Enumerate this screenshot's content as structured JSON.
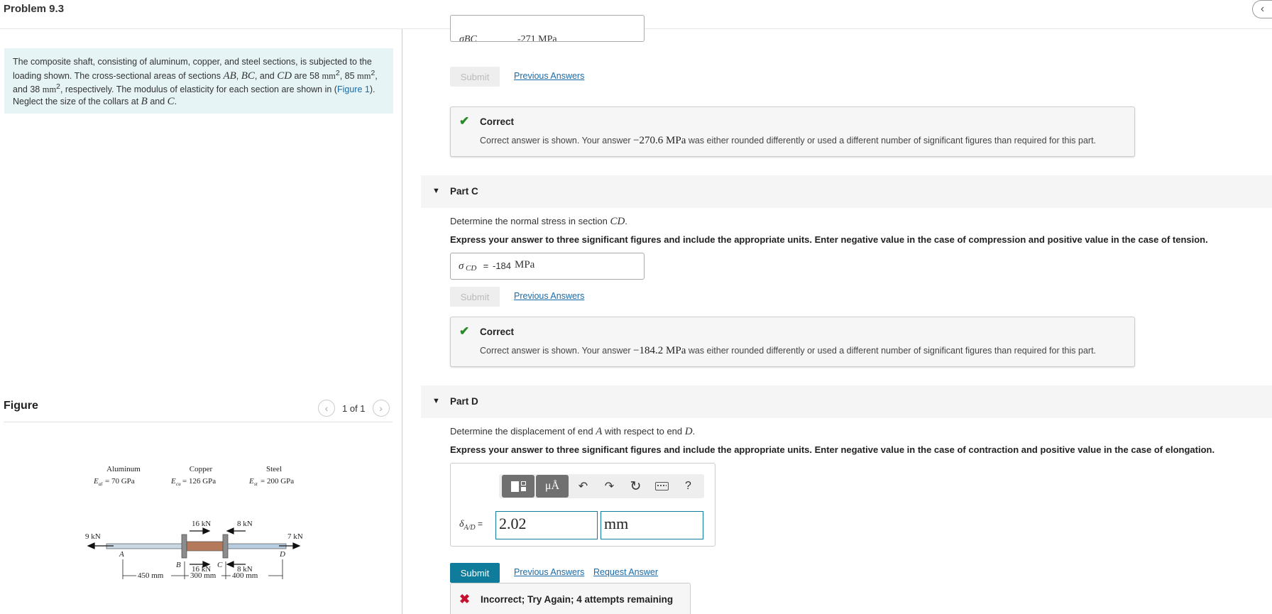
{
  "header": {
    "title": "Problem 9.3",
    "collapse_glyph": "‹"
  },
  "problem": {
    "text_1": "The composite shaft, consisting of aluminum, copper, and steel sections, is subjected to the loading shown. The cross-sectional areas of sections ",
    "ab": "AB",
    "bc": "BC",
    "cd": "CD",
    "and": "and",
    "text_2": " are 58 ",
    "unit": "mm",
    "text_3": ", 85 ",
    "text_4": ", and 38 ",
    "text_5": ", respectively. The modulus of elasticity for each section are shown in (",
    "figure_link": "Figure 1",
    "text_6": "). Neglect the size of the collars at ",
    "b": "B",
    "c": "C",
    "period": "."
  },
  "figure": {
    "label": "Figure",
    "pager": "1 of 1",
    "materials": [
      {
        "name": "Aluminum",
        "modulus": "= 70 GPa",
        "sym": "E",
        "sub": "al"
      },
      {
        "name": "Copper",
        "modulus": "= 126 GPa",
        "sym": "E",
        "sub": "cu"
      },
      {
        "name": "Steel",
        "modulus": "= 200 GPa",
        "sym": "E",
        "sub": "st"
      }
    ],
    "loads": {
      "a": "9 kN",
      "b_top": "16 kN",
      "b_bottom": "16 kN",
      "c_top": "8 kN",
      "c_bottom": "8 kN",
      "d": "7 kN"
    },
    "points": {
      "a": "A",
      "b": "B",
      "c": "C",
      "d": "D"
    },
    "dims": {
      "ab": "450 mm",
      "bc": "300 mm",
      "cd": "400 mm"
    },
    "colors": {
      "aluminum": "#c9d8e4",
      "copper": "#b4785a",
      "steel": "#b8cde0",
      "collar": "#8c8c8c"
    }
  },
  "part_b": {
    "answer_label_partial": "σBC",
    "answer_value_partial": "-271 MPa",
    "submit": "Submit",
    "previous": "Previous Answers",
    "feedback": {
      "status": "Correct",
      "msg_1": "Correct answer is shown. Your answer ",
      "value": "−270.6 MPa",
      "msg_2": " was either rounded differently or used a different number of significant figures than required for this part."
    }
  },
  "part_c": {
    "title": "Part C",
    "question_1": "Determine the normal stress in section ",
    "question_var": "CD",
    "question_2": ".",
    "instructions": "Express your answer to three significant figures and include the appropriate units. Enter negative value in the case of compression and positive value in the case of tension.",
    "answer_label": "σ",
    "answer_sub": "CD",
    "answer_eq": " = ",
    "answer_num": "-184",
    "answer_unit": "MPa",
    "submit": "Submit",
    "previous": "Previous Answers",
    "feedback": {
      "status": "Correct",
      "msg_1": "Correct answer is shown. Your answer ",
      "value": "−184.2 MPa",
      "msg_2": " was either rounded differently or used a different number of significant figures than required for this part."
    }
  },
  "part_d": {
    "title": "Part D",
    "question_1": "Determine the displacement of end ",
    "question_var_a": "A",
    "question_2": " with respect to end ",
    "question_var_d": "D",
    "question_3": ".",
    "instructions": "Express your answer to three significant figures and include the appropriate units. Enter negative value in the case of contraction and positive value in the case of elongation.",
    "delta_label": "δ",
    "delta_sub": "A/D",
    "delta_eq": " = ",
    "value": "2.02",
    "unit": "mm",
    "toolbar": {
      "units": "μÅ",
      "help": "?"
    },
    "submit": "Submit",
    "previous": "Previous Answers",
    "request": "Request Answer",
    "feedback": {
      "status": "Incorrect; Try Again; 4 attempts remaining"
    }
  }
}
